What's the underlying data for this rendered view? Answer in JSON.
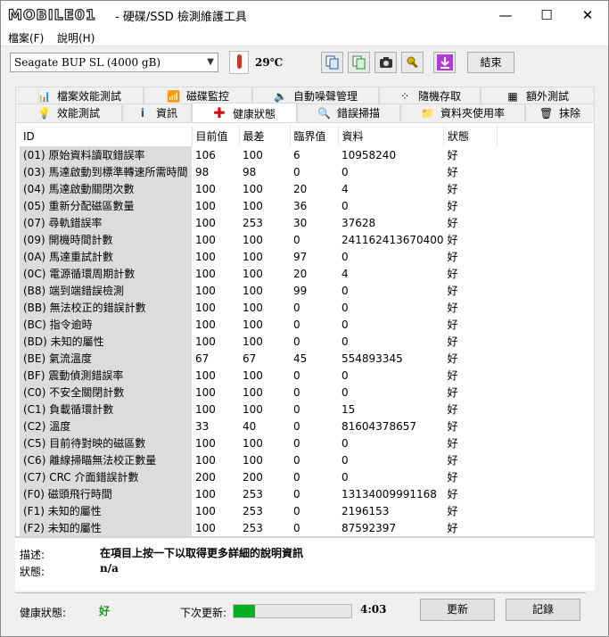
{
  "app_title": "- 硬碟/SSD 檢測維護工具",
  "logo_text": "MOBILE01",
  "window_controls": {
    "minimize": "—",
    "maximize": "☐",
    "close": "✕"
  },
  "menu": [
    "檔案(F)",
    "說明(H)"
  ],
  "drive_select": "Seagate BUP SL (4000 gB)",
  "temperature": "29℃",
  "exit_label": "結束",
  "tabs_row1": [
    "檔案效能測試",
    "磁碟監控",
    "自動噪聲管理",
    "隨機存取",
    "額外測試"
  ],
  "tabs_row2": [
    "效能測試",
    "資訊",
    "健康狀態",
    "錯誤掃描",
    "資料夾使用率",
    "抹除"
  ],
  "active_tab": "健康狀態",
  "table": {
    "headers": [
      "ID",
      "目前值",
      "最差",
      "臨界值",
      "資料",
      "狀態"
    ],
    "rows": [
      [
        "(01) 原始資料讀取錯誤率",
        "106",
        "100",
        "6",
        "10958240",
        "好"
      ],
      [
        "(03) 馬達啟動到標準轉速所需時間",
        "98",
        "98",
        "0",
        "0",
        "好"
      ],
      [
        "(04) 馬達啟動關閉次數",
        "100",
        "100",
        "20",
        "4",
        "好"
      ],
      [
        "(05) 重新分配磁區數量",
        "100",
        "100",
        "36",
        "0",
        "好"
      ],
      [
        "(07) 尋軌錯誤率",
        "100",
        "253",
        "30",
        "37628",
        "好"
      ],
      [
        "(09) 開機時間計數",
        "100",
        "100",
        "0",
        "241162413670400",
        "好"
      ],
      [
        "(0A) 馬達重試計數",
        "100",
        "100",
        "97",
        "0",
        "好"
      ],
      [
        "(0C) 電源循環周期計數",
        "100",
        "100",
        "20",
        "4",
        "好"
      ],
      [
        "(B8) 端到端錯誤檢測",
        "100",
        "100",
        "99",
        "0",
        "好"
      ],
      [
        "(BB) 無法校正的錯誤計數",
        "100",
        "100",
        "0",
        "0",
        "好"
      ],
      [
        "(BC) 指令逾時",
        "100",
        "100",
        "0",
        "0",
        "好"
      ],
      [
        "(BD) 未知的屬性",
        "100",
        "100",
        "0",
        "0",
        "好"
      ],
      [
        "(BE) 氣流溫度",
        "67",
        "67",
        "45",
        "554893345",
        "好"
      ],
      [
        "(BF) 震動偵測錯誤率",
        "100",
        "100",
        "0",
        "0",
        "好"
      ],
      [
        "(C0) 不安全關閉計數",
        "100",
        "100",
        "0",
        "0",
        "好"
      ],
      [
        "(C1) 負載循環計數",
        "100",
        "100",
        "0",
        "15",
        "好"
      ],
      [
        "(C2) 溫度",
        "33",
        "40",
        "0",
        "81604378657",
        "好"
      ],
      [
        "(C5) 目前待對映的磁區數",
        "100",
        "100",
        "0",
        "0",
        "好"
      ],
      [
        "(C6) 離線掃瞄無法校正數量",
        "100",
        "100",
        "0",
        "0",
        "好"
      ],
      [
        "(C7) CRC 介面錯誤計數",
        "200",
        "200",
        "0",
        "0",
        "好"
      ],
      [
        "(F0) 磁頭飛行時間",
        "100",
        "253",
        "0",
        "13134009991168",
        "好"
      ],
      [
        "(F1) 未知的屬性",
        "100",
        "253",
        "0",
        "2196153",
        "好"
      ],
      [
        "(F2) 未知的屬性",
        "100",
        "253",
        "0",
        "87592397",
        "好"
      ]
    ]
  },
  "description": {
    "label": "描述:",
    "value": "在項目上按一下以取得更多詳細的說明資訊"
  },
  "status": {
    "label": "狀態:",
    "value": "n/a"
  },
  "health": {
    "label": "健康狀態:",
    "value": "好",
    "color": "#1a9a1a"
  },
  "next_update": {
    "label": "下次更新:",
    "time": "4:03",
    "progress": 0.18
  },
  "buttons": {
    "update": "更新",
    "log": "記錄"
  }
}
